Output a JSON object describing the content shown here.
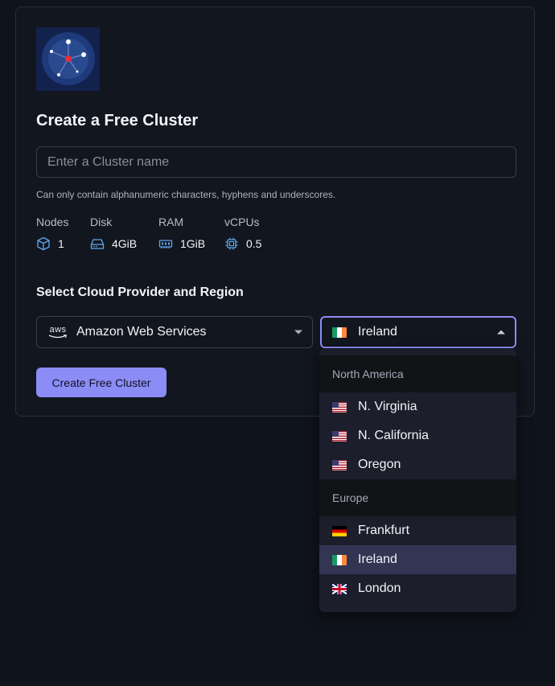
{
  "form": {
    "title": "Create a Free Cluster",
    "name_placeholder": "Enter a Cluster name",
    "name_value": "",
    "hint": "Can only contain alphanumeric characters, hyphens and underscores."
  },
  "specs": [
    {
      "label": "Nodes",
      "value": "1",
      "icon": "cube-icon"
    },
    {
      "label": "Disk",
      "value": "4GiB",
      "icon": "hard-drive-icon"
    },
    {
      "label": "RAM",
      "value": "1GiB",
      "icon": "memory-icon"
    },
    {
      "label": "vCPUs",
      "value": "0.5",
      "icon": "cpu-icon"
    }
  ],
  "provider_section": {
    "title": "Select Cloud Provider and Region",
    "provider_logo_text": "aws",
    "provider": "Amazon Web Services",
    "region": "Ireland"
  },
  "submit_label": "Create Free Cluster",
  "dropdown": {
    "groups": [
      {
        "label": "North America",
        "options": [
          "N. Virginia",
          "N. California",
          "Oregon"
        ]
      },
      {
        "label": "Europe",
        "options": [
          "Frankfurt",
          "Ireland",
          "London"
        ]
      }
    ],
    "selected": "Ireland"
  },
  "colors": {
    "background": "#0f131b",
    "accent": "#8c8cf6",
    "icon_blue": "#5fa8f0",
    "selected_option": "#333652"
  }
}
